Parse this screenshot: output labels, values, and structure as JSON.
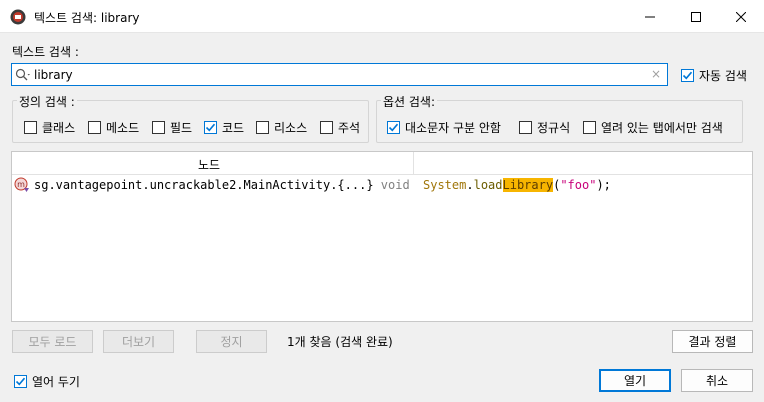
{
  "window": {
    "title": "텍스트 검색: library"
  },
  "search": {
    "label": "텍스트 검색 :",
    "value": "library",
    "clear_glyph": "×",
    "auto_search_label": "자동 검색",
    "auto_search_checked": true
  },
  "definition_group": {
    "title": "정의 검색 :",
    "options": [
      {
        "label": "클래스",
        "checked": false
      },
      {
        "label": "메소드",
        "checked": false
      },
      {
        "label": "필드",
        "checked": false
      },
      {
        "label": "코드",
        "checked": true
      },
      {
        "label": "리소스",
        "checked": false
      },
      {
        "label": "주석",
        "checked": false
      }
    ]
  },
  "options_group": {
    "title": "옵션 검색:",
    "options": [
      {
        "label": "대소문자 구분 안함",
        "checked": true
      },
      {
        "label": "정규식",
        "checked": false
      },
      {
        "label": "열려 있는 탭에서만 검색",
        "checked": false
      }
    ]
  },
  "results": {
    "column_node": "노드",
    "rows": [
      {
        "node": "sg.vantagepoint.uncrackable2.MainActivity.{...}",
        "type": "void",
        "code_prefix_class": "System",
        "code_dot": ".",
        "code_method_start": "load",
        "code_match": "Library",
        "code_open": "(",
        "code_string": "\"foo\"",
        "code_close": ");"
      }
    ]
  },
  "footer": {
    "load_all": "모두 로드",
    "more": "더보기",
    "stop": "정지",
    "status": "1개 찾음 (검색 완료)",
    "sort_results": "결과 정렬",
    "keep_open_label": "열어 두기",
    "keep_open_checked": true,
    "open": "열기",
    "cancel": "취소"
  },
  "colors": {
    "accent": "#0078d7",
    "highlight": "#f7b500"
  }
}
